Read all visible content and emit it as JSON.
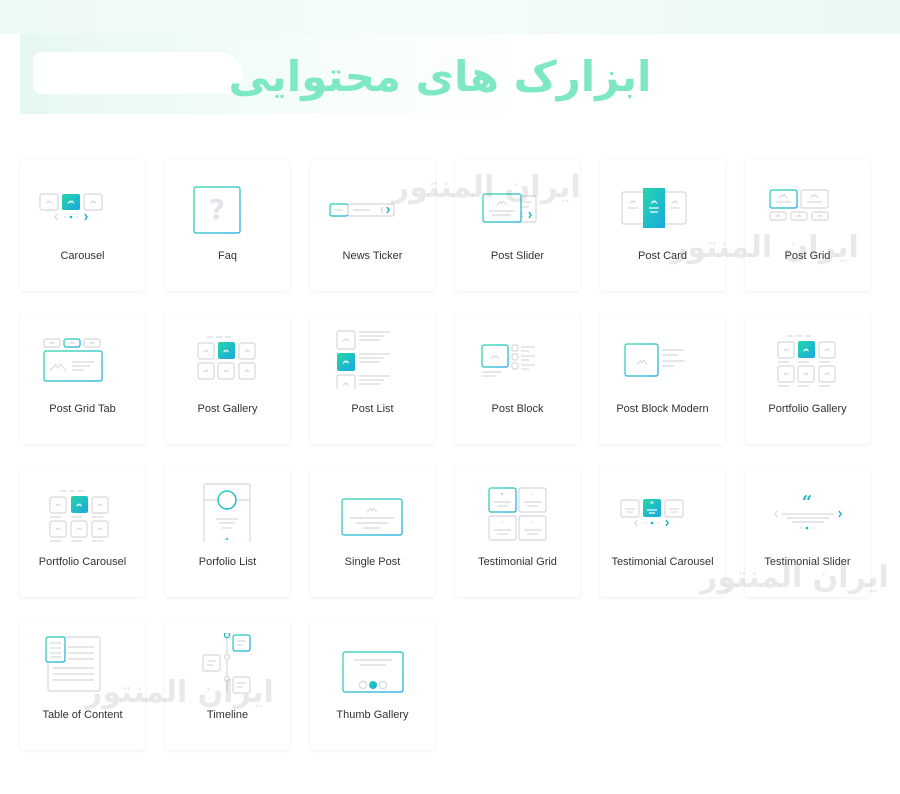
{
  "page": {
    "title": "ابزارک های محتوایی",
    "watermark_text": "ایران المنتور"
  },
  "colors": {
    "accent_start": "#25d6a9",
    "accent_end": "#1aa8e0",
    "title": "#7ee8c5",
    "icon_gray": "#d6d8de"
  },
  "widgets": [
    {
      "label": "Carousel",
      "icon": "carousel-icon"
    },
    {
      "label": "Faq",
      "icon": "faq-icon"
    },
    {
      "label": "News Ticker",
      "icon": "news-ticker-icon"
    },
    {
      "label": "Post Slider",
      "icon": "post-slider-icon"
    },
    {
      "label": "Post Card",
      "icon": "post-card-icon"
    },
    {
      "label": "Post Grid",
      "icon": "post-grid-icon"
    },
    {
      "label": "Post Grid Tab",
      "icon": "post-grid-tab-icon"
    },
    {
      "label": "Post Gallery",
      "icon": "post-gallery-icon"
    },
    {
      "label": "Post List",
      "icon": "post-list-icon"
    },
    {
      "label": "Post Block",
      "icon": "post-block-icon"
    },
    {
      "label": "Post Block Modern",
      "icon": "post-block-modern-icon"
    },
    {
      "label": "Portfolio Gallery",
      "icon": "portfolio-gallery-icon"
    },
    {
      "label": "Portfolio Carousel",
      "icon": "portfolio-carousel-icon"
    },
    {
      "label": "Porfolio List",
      "icon": "portfolio-list-icon"
    },
    {
      "label": "Single Post",
      "icon": "single-post-icon"
    },
    {
      "label": "Testimonial Grid",
      "icon": "testimonial-grid-icon"
    },
    {
      "label": "Testimonial Carousel",
      "icon": "testimonial-carousel-icon"
    },
    {
      "label": "Testimonial Slider",
      "icon": "testimonial-slider-icon"
    },
    {
      "label": "Table of Content",
      "icon": "table-of-content-icon"
    },
    {
      "label": "Timeline",
      "icon": "timeline-icon"
    },
    {
      "label": "Thumb Gallery",
      "icon": "thumb-gallery-icon"
    }
  ]
}
